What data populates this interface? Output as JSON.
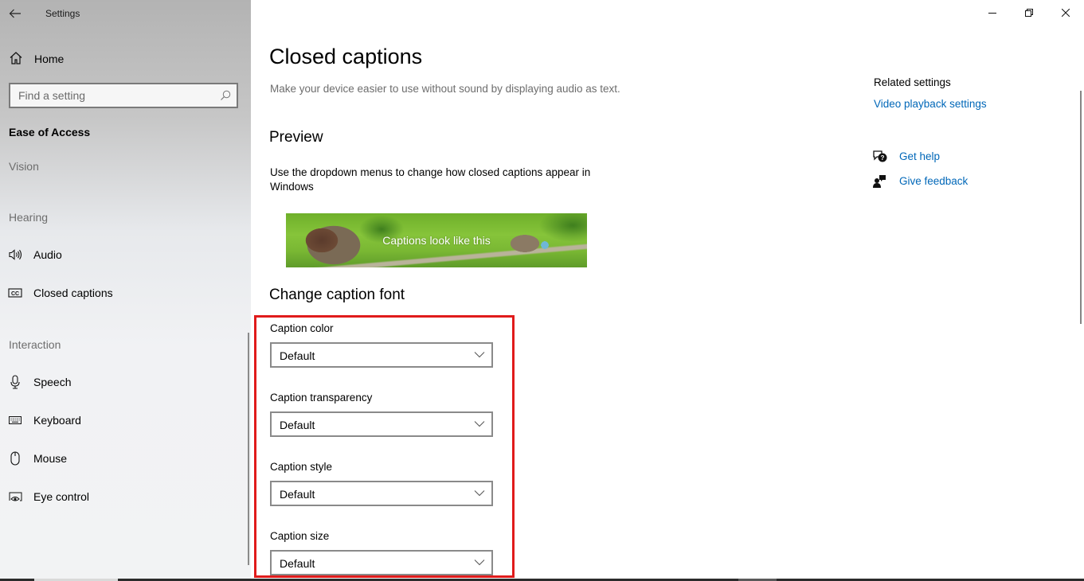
{
  "window": {
    "app_title": "Settings",
    "controls": {
      "minimize": "minimize-icon",
      "restore": "restore-icon",
      "close": "close-icon"
    }
  },
  "sidebar": {
    "back_icon": "back-arrow-icon",
    "home": {
      "label": "Home",
      "icon": "home-icon"
    },
    "search": {
      "placeholder": "Find a setting",
      "value": "",
      "icon": "search-icon"
    },
    "section_title": "Ease of Access",
    "groups": [
      {
        "label": "Vision",
        "items": []
      },
      {
        "label": "Hearing",
        "items": [
          {
            "label": "Audio",
            "icon": "speaker-icon"
          },
          {
            "label": "Closed captions",
            "icon": "closed-captions-icon",
            "selected": true
          }
        ]
      },
      {
        "label": "Interaction",
        "items": [
          {
            "label": "Speech",
            "icon": "microphone-icon"
          },
          {
            "label": "Keyboard",
            "icon": "keyboard-icon"
          },
          {
            "label": "Mouse",
            "icon": "mouse-icon"
          },
          {
            "label": "Eye control",
            "icon": "eye-control-icon"
          }
        ]
      }
    ]
  },
  "main": {
    "title": "Closed captions",
    "description": "Make your device easier to use without sound by displaying audio as text.",
    "preview": {
      "heading": "Preview",
      "text": "Use the dropdown menus to change how closed captions appear in Windows",
      "sample_caption": "Captions look like this"
    },
    "caption_font": {
      "heading": "Change caption font",
      "fields": [
        {
          "label": "Caption color",
          "value": "Default"
        },
        {
          "label": "Caption transparency",
          "value": "Default"
        },
        {
          "label": "Caption style",
          "value": "Default"
        },
        {
          "label": "Caption size",
          "value": "Default"
        }
      ]
    },
    "highlight_color": "#e01b1b"
  },
  "related": {
    "title": "Related settings",
    "link": "Video playback settings",
    "help": [
      {
        "label": "Get help",
        "icon": "get-help-icon"
      },
      {
        "label": "Give feedback",
        "icon": "give-feedback-icon"
      }
    ],
    "link_color": "#0067b8"
  }
}
